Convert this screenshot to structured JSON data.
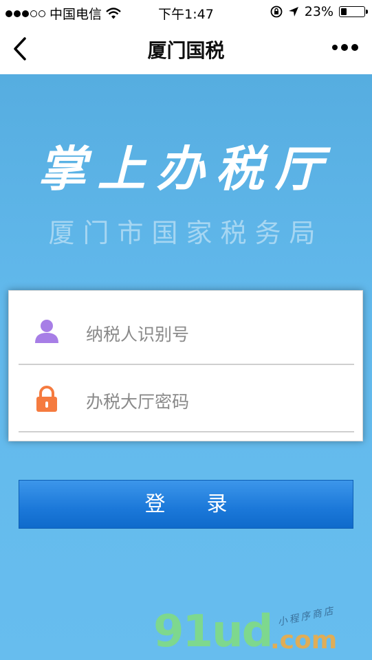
{
  "status_bar": {
    "carrier": "中国电信",
    "time": "下午1:47",
    "battery": "23%"
  },
  "nav": {
    "title": "厦门国税"
  },
  "hero": {
    "title": "掌上办税厅",
    "subtitle": "厦门市国家税务局"
  },
  "form": {
    "taxpayer_id_placeholder": "纳税人识别号",
    "password_placeholder": "办税大厅密码",
    "login_label": "登录"
  },
  "watermark": {
    "brand": "91ud",
    "domain": ".com",
    "tagline": "小程序商店"
  },
  "colors": {
    "background": "#62b9ec",
    "button": "#1b78d9",
    "user_icon": "#a77ee6",
    "lock_icon": "#f57b3f"
  }
}
